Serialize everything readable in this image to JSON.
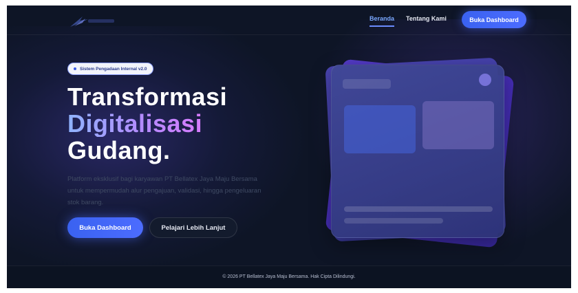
{
  "nav": {
    "links": [
      "Beranda",
      "Tentang Kami"
    ],
    "active": "Beranda",
    "cta_label": "Buka Dashboard"
  },
  "hero": {
    "badge": "Sistem Pengadaan Internal v2.0",
    "title_line1": "Transformasi",
    "title_line2": "Digitalisasi",
    "title_line3": "Gudang.",
    "description": "Platform eksklusif bagi karyawan PT Bellatex Jaya Maju Bersama untuk mempermudah alur pengajuan, validasi, hingga pengeluaran stok barang.",
    "primary_button": "Buka Dashboard",
    "secondary_button": "Pelajari Lebih Lanjut"
  },
  "footer": {
    "text": "© 2026 PT Bellatex Jaya Maju Bersama. Hak Cipta Dilindungi."
  },
  "colors": {
    "background": "#0e1526",
    "accent": "#4c6cff",
    "gradient_text_start": "#8fb3ff",
    "gradient_text_end": "#d77bff"
  },
  "icons": {
    "logo": "company-logo-arrow",
    "badge_dot": "status-dot-icon"
  }
}
